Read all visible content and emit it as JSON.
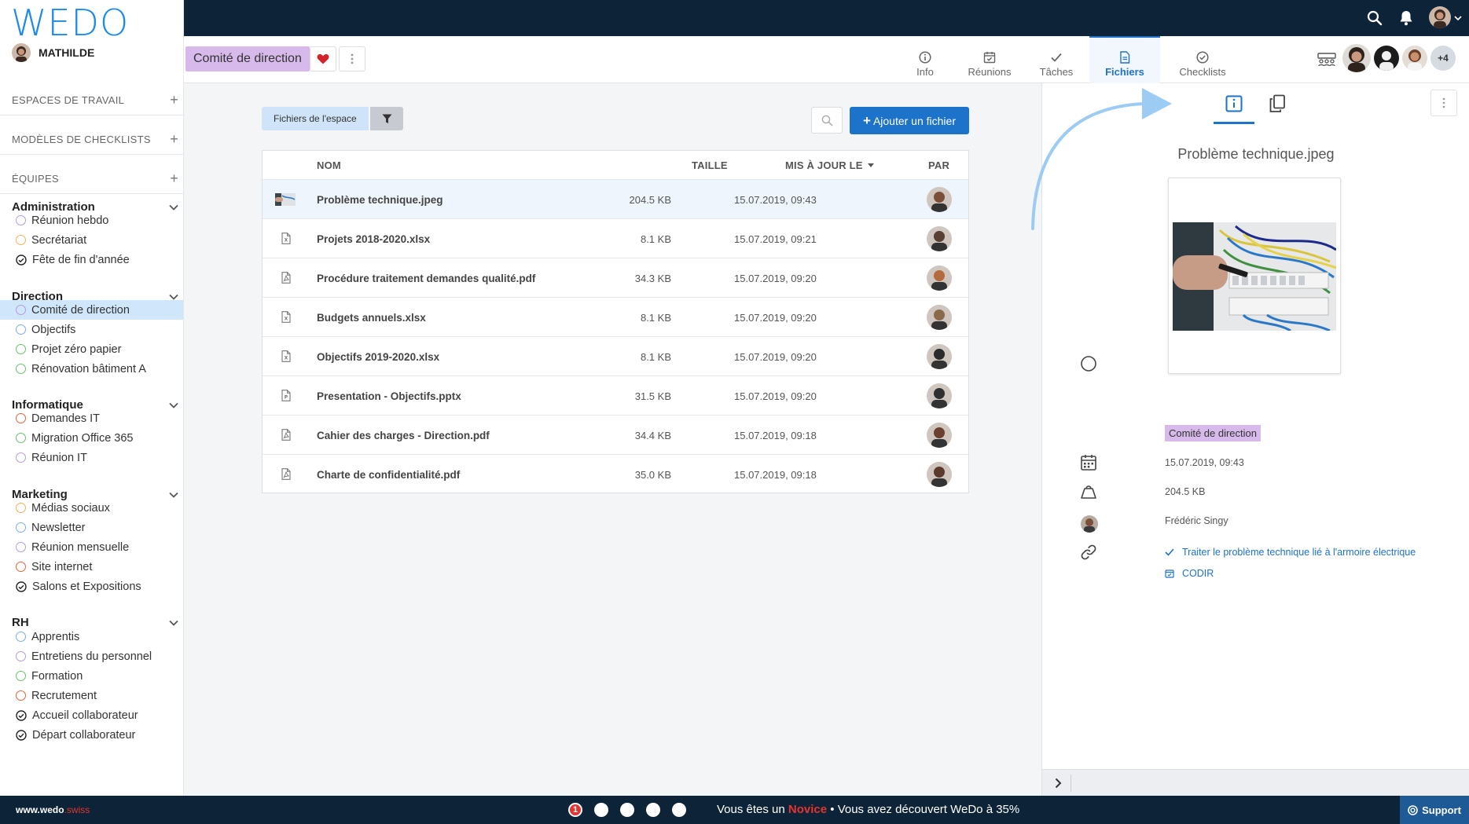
{
  "brand": {
    "logo": "WEDO",
    "footer_site": "www.wedo",
    "footer_site_suffix": ".swiss"
  },
  "user": {
    "name": "MATHILDE"
  },
  "sidebar": {
    "sections": [
      {
        "label": "ESPACES DE TRAVAIL"
      },
      {
        "label": "MODÈLES DE CHECKLISTS"
      },
      {
        "label": "ÉQUIPES"
      }
    ],
    "groups": [
      {
        "name": "Administration",
        "items": [
          {
            "label": "Réunion hebdo",
            "type": "ring",
            "color": "#b89ad9"
          },
          {
            "label": "Secrétariat",
            "type": "ring",
            "color": "#f2b15d"
          },
          {
            "label": "Fête de fin d'année",
            "type": "check"
          }
        ]
      },
      {
        "name": "Direction",
        "items": [
          {
            "label": "Comité de direction",
            "type": "ring",
            "color": "#b89ad9",
            "active": true
          },
          {
            "label": "Objectifs",
            "type": "ring",
            "color": "#7aaee8"
          },
          {
            "label": "Projet zéro papier",
            "type": "ring",
            "color": "#6cc06a"
          },
          {
            "label": "Rénovation bâtiment A",
            "type": "ring",
            "color": "#6cc06a"
          }
        ]
      },
      {
        "name": "Informatique",
        "items": [
          {
            "label": "Demandes IT",
            "type": "ring",
            "color": "#e0643c"
          },
          {
            "label": "Migration Office 365",
            "type": "ring",
            "color": "#6cc06a"
          },
          {
            "label": "Réunion IT",
            "type": "ring",
            "color": "#b89ad9"
          }
        ]
      },
      {
        "name": "Marketing",
        "items": [
          {
            "label": "Médias sociaux",
            "type": "ring",
            "color": "#f2b15d"
          },
          {
            "label": "Newsletter",
            "type": "ring",
            "color": "#7aaee8"
          },
          {
            "label": "Réunion mensuelle",
            "type": "ring",
            "color": "#b89ad9"
          },
          {
            "label": "Site internet",
            "type": "ring",
            "color": "#e0643c"
          },
          {
            "label": "Salons et Expositions",
            "type": "check"
          }
        ]
      },
      {
        "name": "RH",
        "items": [
          {
            "label": "Apprentis",
            "type": "ring",
            "color": "#7aaee8"
          },
          {
            "label": "Entretiens du personnel",
            "type": "ring",
            "color": "#b89ad9"
          },
          {
            "label": "Formation",
            "type": "ring",
            "color": "#6cc06a"
          },
          {
            "label": "Recrutement",
            "type": "ring",
            "color": "#e0643c"
          },
          {
            "label": "Accueil collaborateur",
            "type": "check"
          },
          {
            "label": "Départ collaborateur",
            "type": "check"
          }
        ]
      }
    ]
  },
  "header": {
    "workspace": "Comité de direction",
    "tabs": [
      {
        "label": "Info"
      },
      {
        "label": "Réunions"
      },
      {
        "label": "Tâches"
      },
      {
        "label": "Fichiers",
        "active": true
      },
      {
        "label": "Checklists"
      }
    ],
    "members_more": "+4"
  },
  "toolbar": {
    "space_files": "Fichiers de l'espace",
    "add_file": "Ajouter un fichier"
  },
  "table": {
    "columns": {
      "name": "NOM",
      "size": "TAILLE",
      "updated": "MIS À JOUR LE",
      "by": "PAR"
    },
    "rows": [
      {
        "name": "Problème technique.jpeg",
        "size": "204.5 KB",
        "date": "15.07.2019, 09:43",
        "kind": "image",
        "skin": "#7a5038"
      },
      {
        "name": "Projets 2018-2020.xlsx",
        "size": "8.1 KB",
        "date": "15.07.2019, 09:21",
        "kind": "xlsx",
        "skin": "#5a3f33"
      },
      {
        "name": "Procédure traitement demandes qualité.pdf",
        "size": "34.3 KB",
        "date": "15.07.2019, 09:20",
        "kind": "pdf",
        "skin": "#b36a3d"
      },
      {
        "name": "Budgets annuels.xlsx",
        "size": "8.1 KB",
        "date": "15.07.2019, 09:20",
        "kind": "xlsx",
        "skin": "#8a6a4b"
      },
      {
        "name": "Objectifs 2019-2020.xlsx",
        "size": "8.1 KB",
        "date": "15.07.2019, 09:20",
        "kind": "xlsx",
        "skin": "#2b2b2b"
      },
      {
        "name": "Presentation - Objectifs.pptx",
        "size": "31.5 KB",
        "date": "15.07.2019, 09:20",
        "kind": "pptx",
        "skin": "#303030"
      },
      {
        "name": "Cahier des charges - Direction.pdf",
        "size": "34.4 KB",
        "date": "15.07.2019, 09:18",
        "kind": "pdf",
        "skin": "#6b4030"
      },
      {
        "name": "Charte de confidentialité.pdf",
        "size": "35.0 KB",
        "date": "15.07.2019, 09:18",
        "kind": "pdf",
        "skin": "#5c3b2c"
      }
    ]
  },
  "preview": {
    "title": "Problème technique.jpeg",
    "workspace": "Comité de direction",
    "date": "15.07.2019, 09:43",
    "size": "204.5 KB",
    "author": "Frédéric Singy",
    "linked_task": "Traiter le problème technique lié à l'armoire électrique",
    "linked_meeting": "CODIR"
  },
  "footer": {
    "progress_text_1": "Vous êtes un ",
    "level": "Novice",
    "progress_text_2": " • Vous avez découvert WeDo à 35%",
    "step_current": "1",
    "support": "Support"
  },
  "colors": {
    "accent": "#1d72c9",
    "dark": "#0d2338",
    "novice": "#e4342f"
  }
}
